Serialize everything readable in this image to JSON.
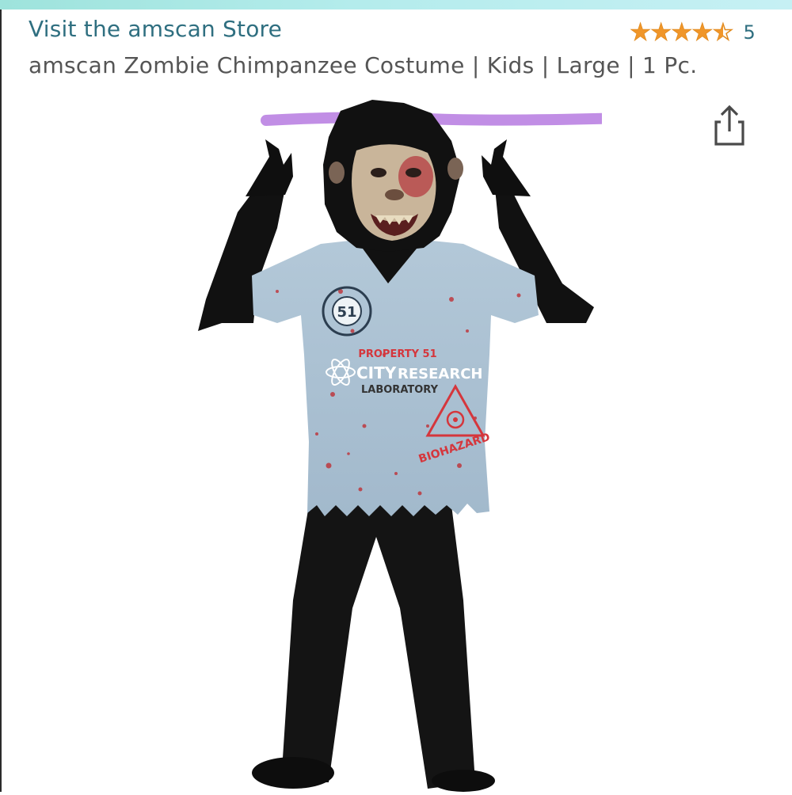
{
  "store": {
    "link_label": "Visit the amscan Store"
  },
  "rating": {
    "stars": 4.5,
    "max": 5,
    "count": "5",
    "star_color": "#f0962a"
  },
  "product": {
    "title": "amscan Zombie Chimpanzee Costume | Kids | Large | 1 Pc.",
    "image": {
      "alt": "amscan Zombie Chimpanzee Costume | Kids | Large | 1 Pc.",
      "badge_number": "51",
      "shirt_line1": "PROPERTY 51",
      "shirt_city": "CITY",
      "shirt_research": "RESEARCH",
      "shirt_lab": "LABORATORY",
      "hazard_label": "BIOHAZARD"
    }
  },
  "icons": {
    "share": "share-icon",
    "star": "star-icon"
  },
  "colors": {
    "link": "#2f6f80",
    "title": "#555555",
    "highlight": "#b67ae0"
  }
}
